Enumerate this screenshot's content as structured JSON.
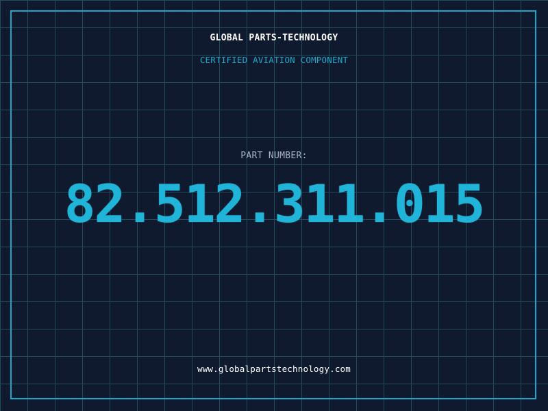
{
  "header": {
    "company_name": "GLOBAL PARTS-TECHNOLOGY",
    "tagline": "CERTIFIED AVIATION COMPONENT"
  },
  "part": {
    "label": "PART NUMBER:",
    "number": "82.512.311.015"
  },
  "footer": {
    "website": "www.globalpartstechnology.com"
  },
  "colors": {
    "background": "#101a2e",
    "grid": "#1f4d5e",
    "accent": "#1aa7c9",
    "text": "#ffffff",
    "muted": "#a8b3c2"
  }
}
